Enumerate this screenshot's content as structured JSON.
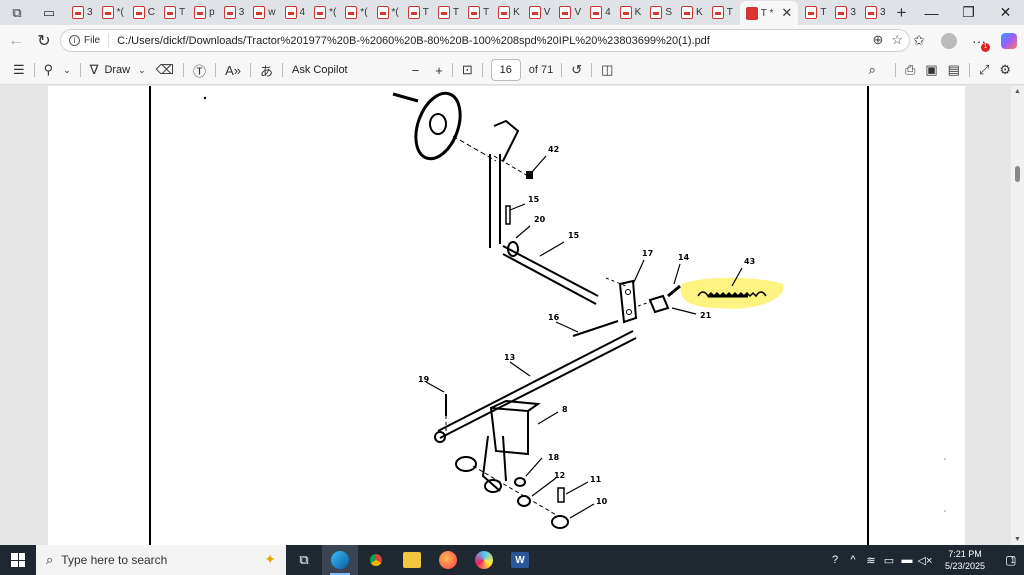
{
  "browser": {
    "tab_count_label": "",
    "tabs": [
      {
        "letter": "3"
      },
      {
        "letter": "*("
      },
      {
        "letter": "C"
      },
      {
        "letter": "T"
      },
      {
        "letter": "p"
      },
      {
        "letter": "3"
      },
      {
        "letter": "w"
      },
      {
        "letter": "4"
      },
      {
        "letter": "*("
      },
      {
        "letter": "*("
      },
      {
        "letter": "*("
      },
      {
        "letter": "T"
      },
      {
        "letter": "T"
      },
      {
        "letter": "T"
      },
      {
        "letter": "K"
      },
      {
        "letter": "V"
      },
      {
        "letter": "V"
      },
      {
        "letter": "4"
      },
      {
        "letter": "K"
      },
      {
        "letter": "S"
      },
      {
        "letter": "K"
      },
      {
        "letter": "T"
      }
    ],
    "active_tab": {
      "letter": "T",
      "marker": "*"
    },
    "tabs_after": [
      {
        "letter": "T"
      },
      {
        "letter": "3"
      },
      {
        "letter": "3"
      }
    ],
    "new_tab_glyph": "+",
    "window_controls": {
      "minimize": "—",
      "restore": "❐",
      "close": "✕"
    }
  },
  "addressbar": {
    "back_glyph": "←",
    "reload_glyph": "↻",
    "file_label": "File",
    "url": "C:/Users/dickf/Downloads/Tractor%201977%20B-%2060%20B-80%20B-100%208spd%20IPL%20%23803699%20(1).pdf",
    "badge_count": "1"
  },
  "pdf_toolbar": {
    "draw_label": "Draw",
    "ask_copilot_label": "Ask Copilot",
    "zoom_out_glyph": "−",
    "zoom_in_glyph": "+",
    "current_page": "16",
    "total_pages": "of 71"
  },
  "diagram": {
    "callouts": [
      "42",
      "15",
      "20",
      "15",
      "17",
      "14",
      "43",
      "16",
      "21",
      "13",
      "19",
      "8",
      "18",
      "12",
      "11",
      "10"
    ],
    "highlight_color": "#fff27a"
  },
  "taskbar": {
    "search_placeholder": "Type here to search",
    "time": "7:21 PM",
    "date": "5/23/2025",
    "notification_count": "1"
  },
  "colors": {
    "accent": "#0078d4",
    "pdf_red": "#d33"
  }
}
